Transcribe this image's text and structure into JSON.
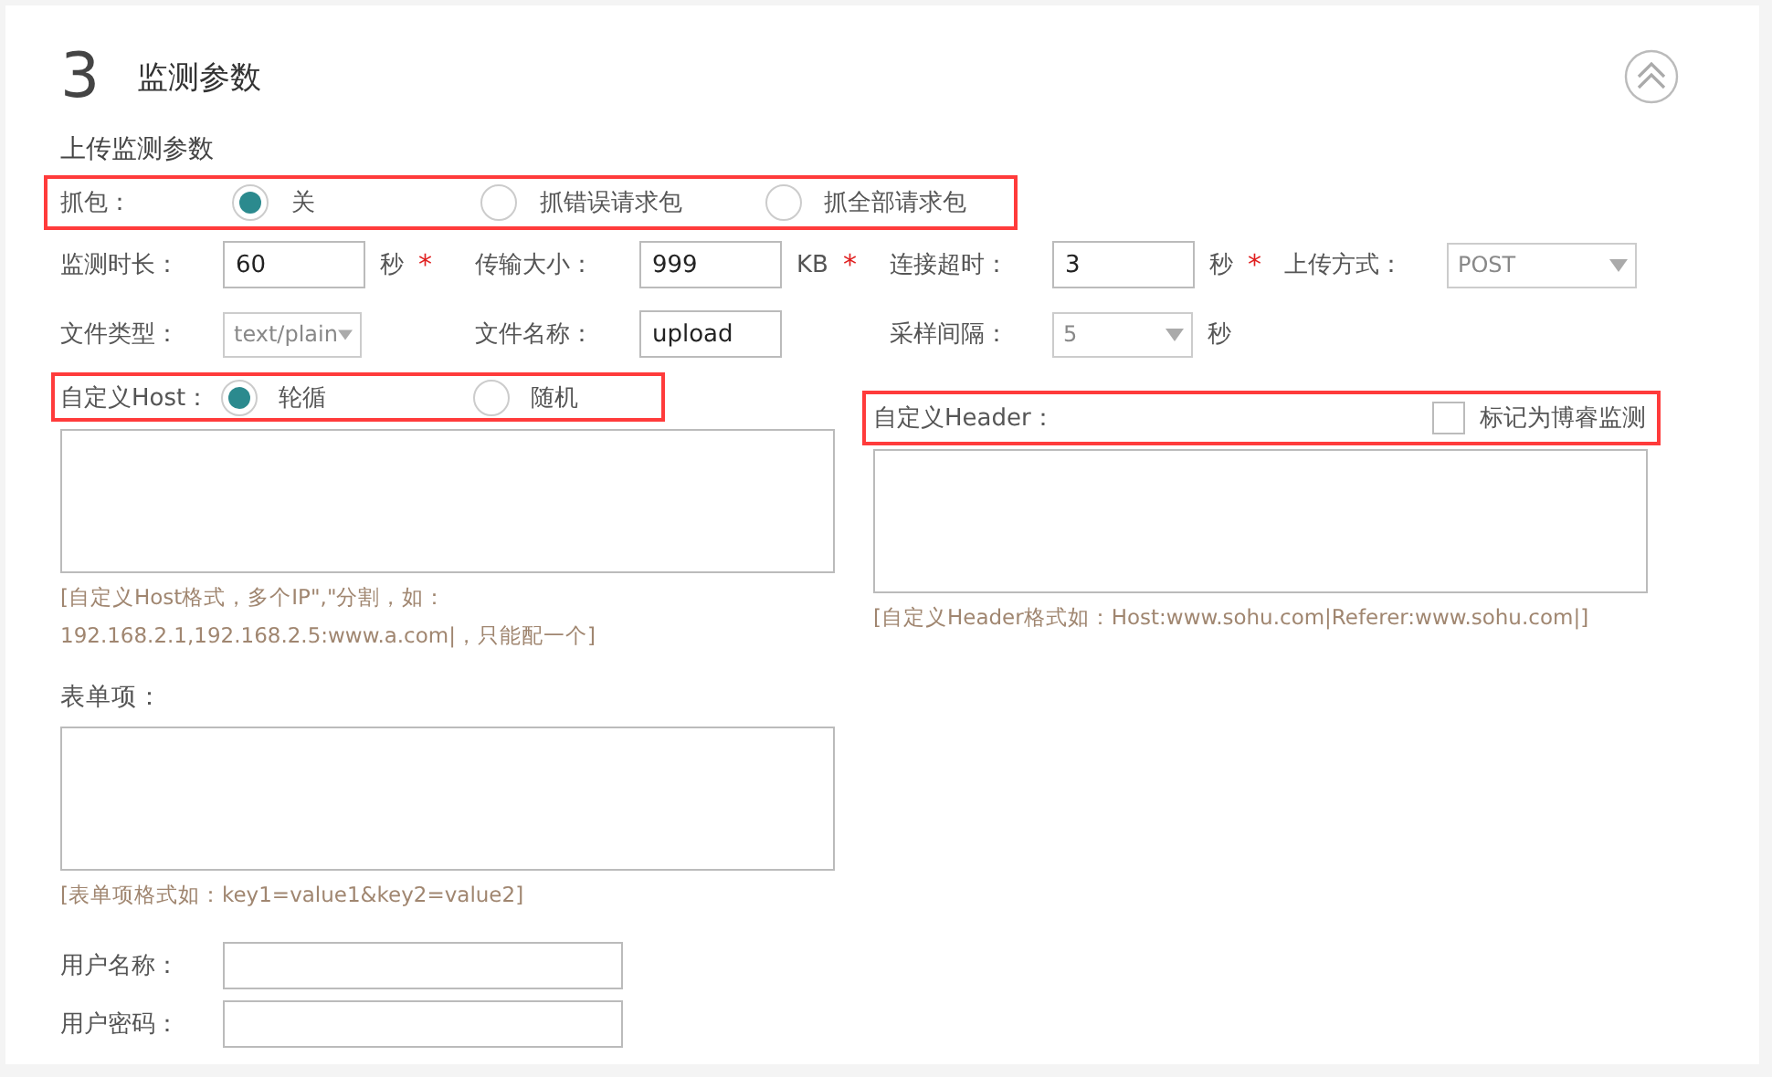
{
  "section": {
    "number": "3",
    "title": "监测参数",
    "expanded": true
  },
  "subtitle": "上传监测参数",
  "capture": {
    "label": "抓包：",
    "options": [
      {
        "label": "关",
        "selected": true
      },
      {
        "label": "抓错误请求包",
        "selected": false
      },
      {
        "label": "抓全部请求包",
        "selected": false
      }
    ]
  },
  "param_rows": [
    [
      {
        "label": "监测时长：",
        "kind": "input",
        "value": "60",
        "unit": "秒",
        "mark": "*"
      },
      {
        "label": "传输大小：",
        "kind": "input",
        "value": "999",
        "unit": "KB",
        "mark": "*"
      },
      {
        "label": "连接超时：",
        "kind": "input",
        "value": "3",
        "unit": "秒",
        "mark": "*"
      },
      {
        "label": "上传方式：",
        "kind": "select",
        "value": "POST"
      }
    ],
    [
      {
        "label": "文件类型：",
        "kind": "select",
        "value": "text/plain"
      },
      {
        "label": "文件名称：",
        "kind": "input",
        "value": "upload"
      },
      {
        "label": "采样间隔：",
        "kind": "select",
        "value": "5",
        "unit": "秒"
      }
    ]
  ],
  "host": {
    "label": "自定义Host：",
    "options": [
      {
        "label": "轮循",
        "selected": true
      },
      {
        "label": "随机",
        "selected": false
      }
    ],
    "hint": "[自定义Host格式，多个IP\",\"分割，如：192.168.2.1,192.168.2.5:www.a.com|，只能配一个]"
  },
  "header": {
    "label": "自定义Header：",
    "checkbox": {
      "label": "标记为博睿监测",
      "checked": false
    },
    "hint": "[自定义Header格式如：Host:www.sohu.com|Referer:www.sohu.com|]"
  },
  "form": {
    "label": "表单项：",
    "hint": "[表单项格式如：key1=value1&key2=value2]"
  },
  "credentials": [
    {
      "label": "用户名称："
    },
    {
      "label": "用户密码："
    }
  ]
}
